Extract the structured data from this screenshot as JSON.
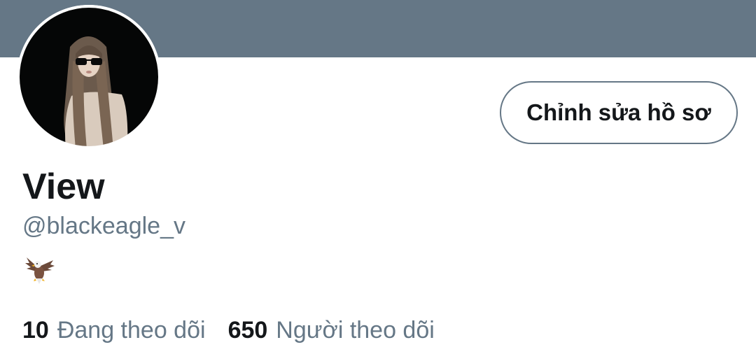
{
  "profile": {
    "display_name": "View",
    "handle": "@blackeagle_v",
    "bio_icon": "eagle-emoji",
    "edit_button_label": "Chỉnh sửa hồ sơ"
  },
  "stats": {
    "following_count": "10",
    "following_label": "Đang theo dõi",
    "followers_count": "650",
    "followers_label": "Người theo dõi"
  },
  "colors": {
    "banner": "#657786",
    "text_primary": "#14171a",
    "text_secondary": "#657786"
  }
}
